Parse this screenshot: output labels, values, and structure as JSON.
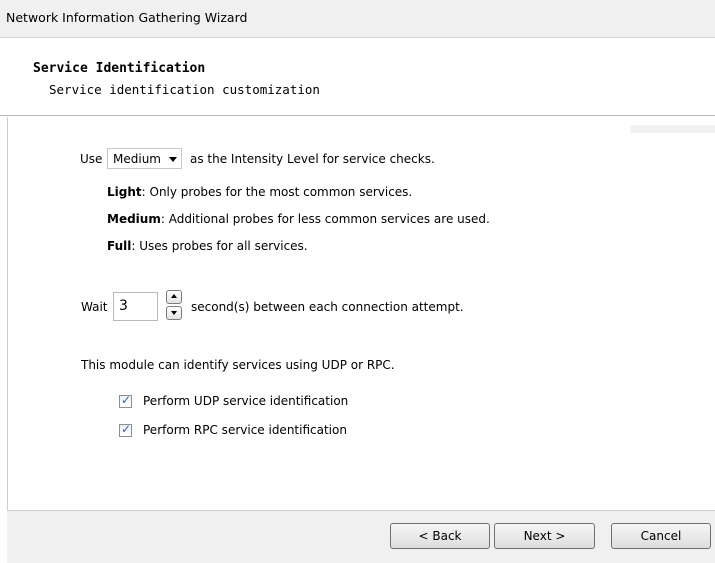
{
  "window": {
    "title": "Network Information Gathering Wizard"
  },
  "header": {
    "title": "Service Identification",
    "subtitle": "Service identification customization"
  },
  "intensity": {
    "prefix": "Use",
    "selected": "Medium",
    "suffix": "as the Intensity Level for service checks."
  },
  "levels": [
    {
      "name": "Light",
      "desc": ": Only probes for the most common services."
    },
    {
      "name": "Medium",
      "desc": ": Additional probes for less common services are used."
    },
    {
      "name": "Full",
      "desc": ": Uses probes for all services."
    }
  ],
  "wait": {
    "prefix": "Wait",
    "value": "3",
    "suffix": "second(s) between each connection attempt."
  },
  "module_text": "This module can identify services using UDP or RPC.",
  "checkboxes": [
    {
      "label": "Perform UDP service identification",
      "checked": true
    },
    {
      "label": "Perform RPC service identification",
      "checked": true
    }
  ],
  "buttons": {
    "back": "< Back",
    "next": "Next >",
    "cancel": "Cancel"
  },
  "colors": {
    "dialog_bg": "#f0f0f0",
    "content_bg": "#ffffff",
    "checkbox_check": "#3b5fa6"
  },
  "icons": [
    "chevron-down-icon",
    "spin-up-icon",
    "spin-down-icon",
    "checkmark-icon"
  ]
}
